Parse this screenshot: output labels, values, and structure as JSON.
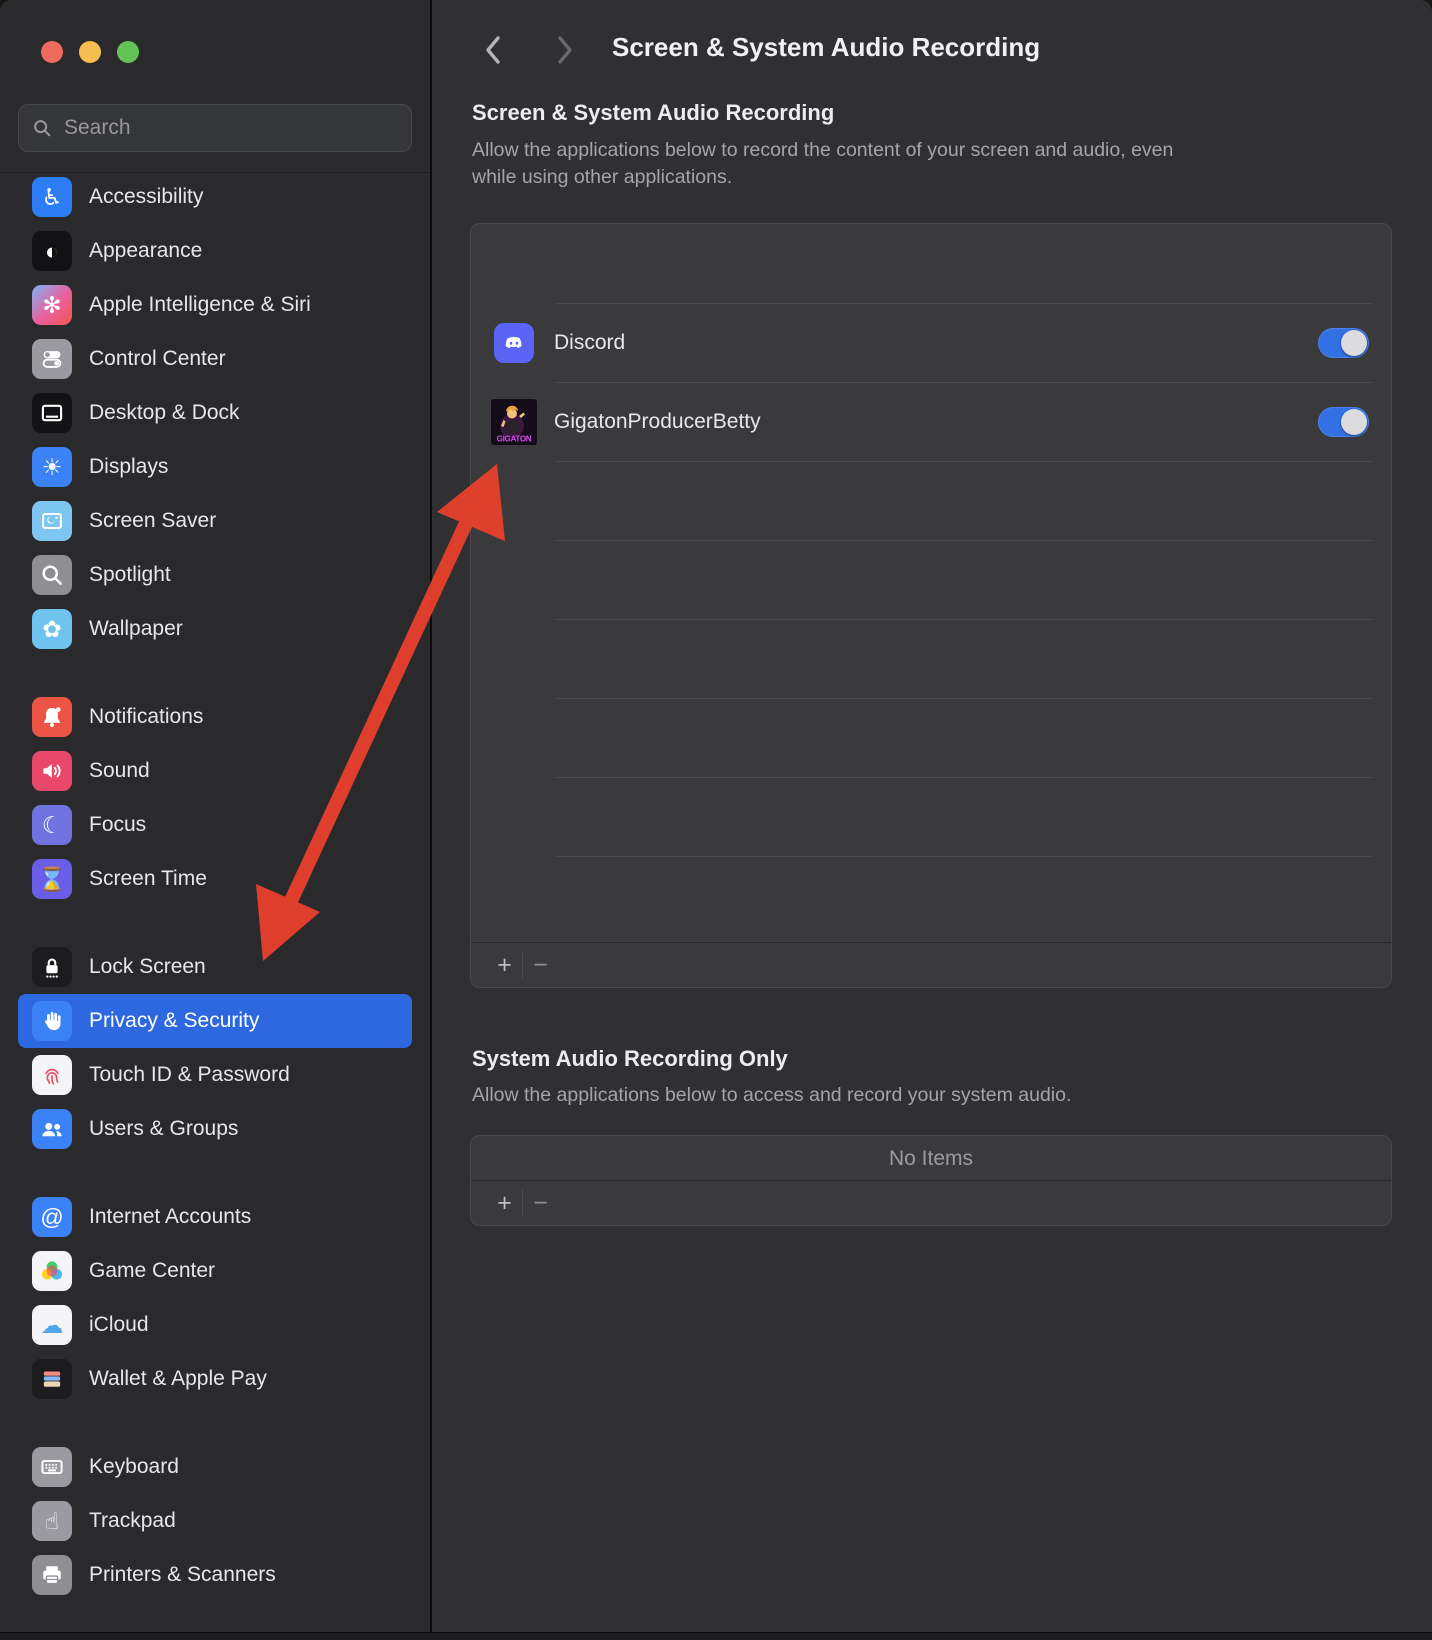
{
  "window": {
    "controls": [
      {
        "name": "close",
        "color": "#ee6a5f"
      },
      {
        "name": "minimize",
        "color": "#f6bd50"
      },
      {
        "name": "zoom",
        "color": "#62c454"
      }
    ]
  },
  "sidebar": {
    "search": {
      "placeholder": "Search",
      "icon": "search-icon"
    },
    "groups": [
      {
        "items": [
          {
            "label": "Accessibility",
            "icon": "accessibility-icon",
            "render": "glyph",
            "glyph": "♿",
            "bg": "#2d7df6"
          },
          {
            "label": "Appearance",
            "icon": "appearance-icon",
            "render": "glyph",
            "glyph": "◐",
            "bg": "#121214"
          },
          {
            "label": "Apple Intelligence & Siri",
            "icon": "apple-intelligence-icon",
            "render": "glyph",
            "glyph": "✻",
            "bg": "linear-gradient(135deg,#7fb3f7 0%,#ec5f9b 55%,#f0574c 100%)"
          },
          {
            "label": "Control Center",
            "icon": "control-center-icon",
            "render": "svg",
            "svg": "controlcenter",
            "bg": "#9a9aa0"
          },
          {
            "label": "Desktop & Dock",
            "icon": "desktop-dock-icon",
            "render": "svg",
            "svg": "desktop",
            "bg": "#121214"
          },
          {
            "label": "Displays",
            "icon": "displays-icon",
            "render": "glyph",
            "glyph": "☀",
            "bg": "#3b82f7"
          },
          {
            "label": "Screen Saver",
            "icon": "screen-saver-icon",
            "render": "svg",
            "svg": "framemoon",
            "bg": "#7cc6f1"
          },
          {
            "label": "Spotlight",
            "icon": "spotlight-icon",
            "render": "svg",
            "svg": "magnifier",
            "bg": "#8e8e93"
          },
          {
            "label": "Wallpaper",
            "icon": "wallpaper-icon",
            "render": "glyph",
            "glyph": "✿",
            "bg": "#6fc4ef"
          }
        ]
      },
      {
        "items": [
          {
            "label": "Notifications",
            "icon": "bell-icon",
            "render": "svg",
            "svg": "bell",
            "bg": "#ec5545"
          },
          {
            "label": "Sound",
            "icon": "speaker-icon",
            "render": "svg",
            "svg": "speaker",
            "bg": "#e9486b"
          },
          {
            "label": "Focus",
            "icon": "moon-icon",
            "render": "glyph",
            "glyph": "☾",
            "bg": "#7174e0"
          },
          {
            "label": "Screen Time",
            "icon": "hourglass-icon",
            "render": "glyph",
            "glyph": "⌛",
            "bg": "#6a5de8"
          }
        ]
      },
      {
        "items": [
          {
            "label": "Lock Screen",
            "icon": "lock-icon",
            "render": "svg",
            "svg": "lock",
            "bg": "#1c1c1e"
          },
          {
            "label": "Privacy & Security",
            "icon": "hand-icon",
            "render": "svg",
            "svg": "hand",
            "bg": "#3b82f7",
            "selected": true
          },
          {
            "label": "Touch ID & Password",
            "icon": "fingerprint-icon",
            "render": "svg",
            "svg": "touchid",
            "bg": "#f5f5f7"
          },
          {
            "label": "Users & Groups",
            "icon": "users-icon",
            "render": "svg",
            "svg": "users",
            "bg": "#3b82f7"
          }
        ]
      },
      {
        "items": [
          {
            "label": "Internet Accounts",
            "icon": "at-sign-icon",
            "render": "glyph",
            "glyph": "@",
            "bg": "#3b82f7"
          },
          {
            "label": "Game Center",
            "icon": "game-center-icon",
            "render": "svg",
            "svg": "gamecenter",
            "bg": "#f5f5f7"
          },
          {
            "label": "iCloud",
            "icon": "cloud-icon",
            "render": "glyph",
            "glyph": "☁",
            "bg": "#f5f5f7",
            "fg": "#53a6e8"
          },
          {
            "label": "Wallet & Apple Pay",
            "icon": "wallet-icon",
            "render": "svg",
            "svg": "wallet",
            "bg": "#1c1c1e"
          }
        ]
      },
      {
        "items": [
          {
            "label": "Keyboard",
            "icon": "keyboard-icon",
            "render": "svg",
            "svg": "keyboard",
            "bg": "#9a9aa0"
          },
          {
            "label": "Trackpad",
            "icon": "trackpad-icon",
            "render": "glyph",
            "glyph": "☝",
            "bg": "#9a9aa0"
          },
          {
            "label": "Printers & Scanners",
            "icon": "printer-icon",
            "render": "svg",
            "svg": "printer",
            "bg": "#8e8e93"
          }
        ]
      }
    ]
  },
  "content": {
    "nav": {
      "back_icon": "chevron-left-icon",
      "forward_icon": "chevron-right-icon"
    },
    "page_title": "Screen & System Audio Recording",
    "screen_recording": {
      "heading": "Screen & System Audio Recording",
      "description_lines": [
        "Allow the applications below to record the content of your screen and audio, even",
        "while using other applications."
      ],
      "apps": [
        {
          "name": "Discord",
          "icon": "discord-app-icon",
          "enabled": true
        },
        {
          "name": "GigatonProducerBetty",
          "icon": "gigaton-producer-betty-app-icon",
          "icon_text": "GIGATON",
          "enabled": true
        }
      ],
      "empty_rows": 6,
      "add_label": "+",
      "remove_label": "−"
    },
    "system_audio": {
      "heading": "System Audio Recording Only",
      "description": "Allow the applications below to access and record your system audio.",
      "empty_label": "No Items",
      "add_label": "+",
      "remove_label": "−"
    }
  },
  "annotation": {
    "shape": "double-headed-arrow",
    "color": "#e8402b"
  },
  "colors": {
    "sidebar_selected": "#2e68e0",
    "toggle_on": "#3171e3",
    "pane_bg": "#303033",
    "sidebar_bg": "#2a2a2c",
    "box_bg": "#3a3a3d"
  }
}
